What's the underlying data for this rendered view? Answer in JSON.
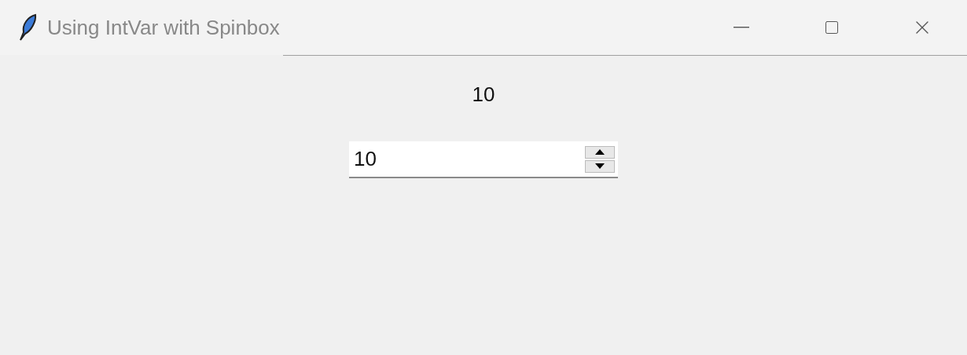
{
  "window": {
    "title": "Using IntVar with Spinbox"
  },
  "label": {
    "text": "10"
  },
  "spinbox": {
    "value": "10"
  }
}
